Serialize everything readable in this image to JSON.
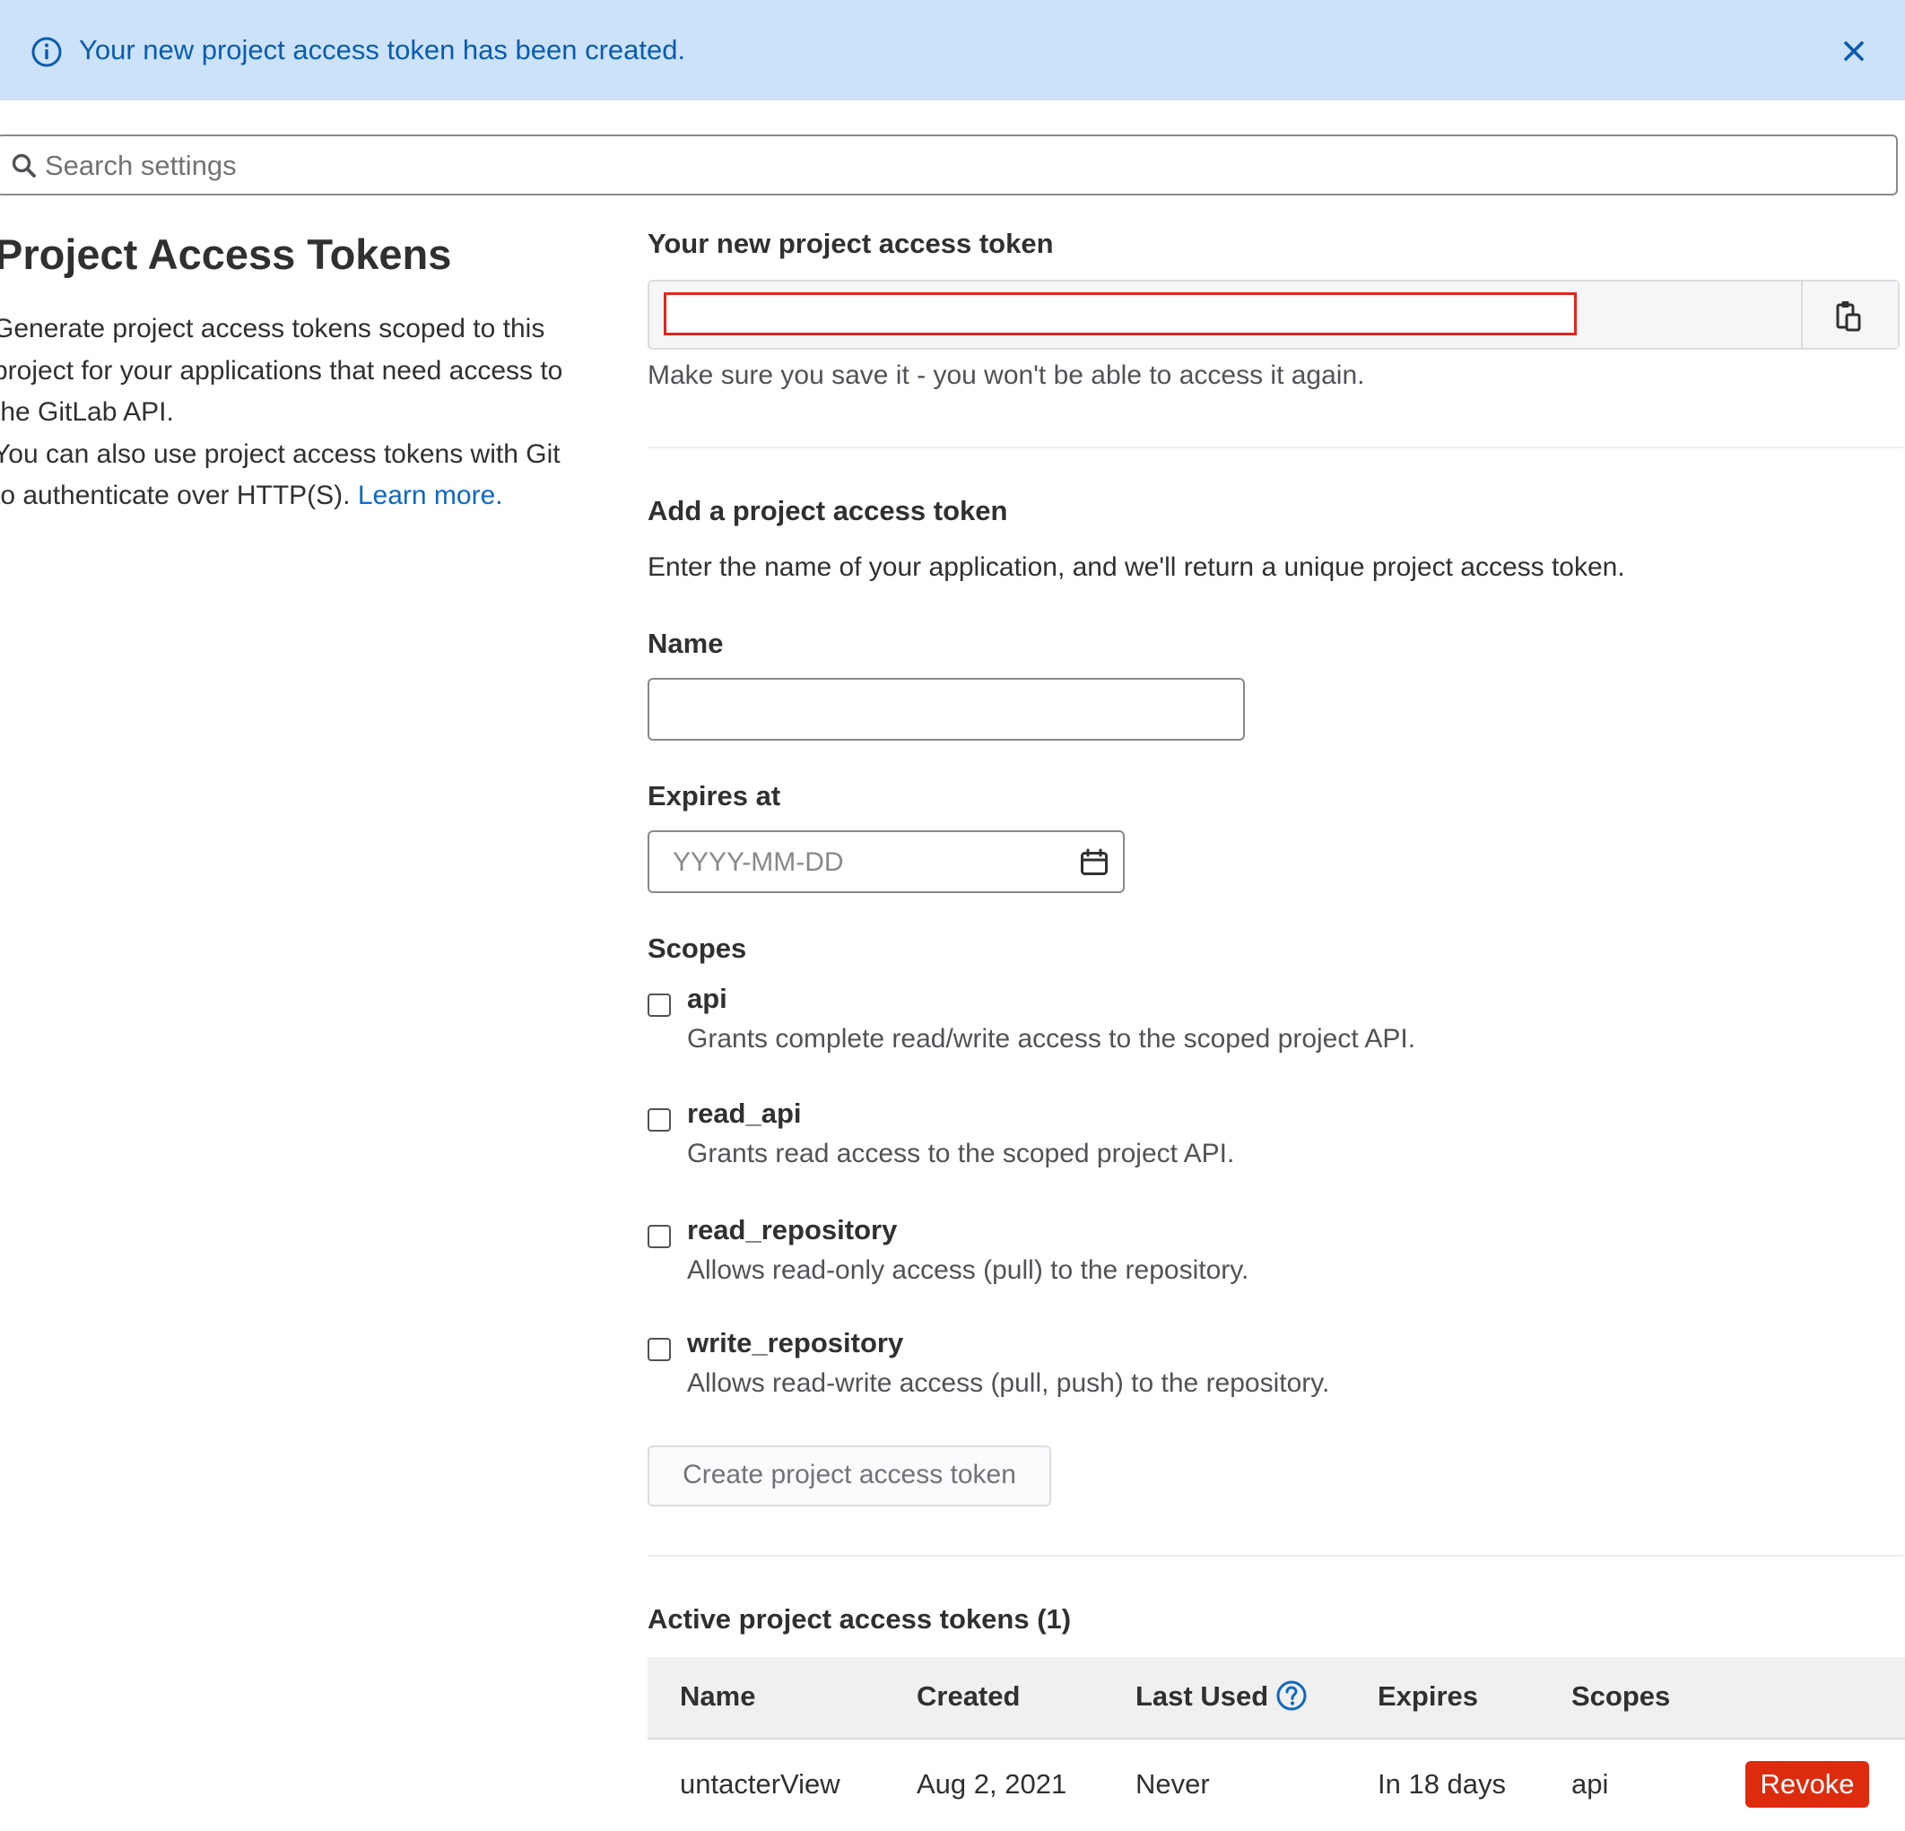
{
  "alert": {
    "message": "Your new project access token has been created.",
    "icon": "info-circle-icon",
    "close_icon": "close-icon"
  },
  "search": {
    "placeholder": "Search settings"
  },
  "sidebar": {
    "title": "Project Access Tokens",
    "description_1": "Generate project access tokens scoped to this project for your applications that need access to the GitLab API.",
    "description_2": "You can also use project access tokens with Git to authenticate over HTTP(S).",
    "learn_more": "Learn more."
  },
  "new_token": {
    "label": "Your new project access token",
    "value": "",
    "help": "Make sure you save it - you won't be able to access it again.",
    "copy_icon": "clipboard-icon"
  },
  "add_token": {
    "heading": "Add a project access token",
    "description": "Enter the name of your application, and we'll return a unique project access token.",
    "name_label": "Name",
    "name_value": "",
    "expires_label": "Expires at",
    "expires_placeholder": "YYYY-MM-DD",
    "scopes_label": "Scopes",
    "scopes": [
      {
        "name": "api",
        "description": "Grants complete read/write access to the scoped project API.",
        "checked": false
      },
      {
        "name": "read_api",
        "description": "Grants read access to the scoped project API.",
        "checked": false
      },
      {
        "name": "read_repository",
        "description": "Allows read-only access (pull) to the repository.",
        "checked": false
      },
      {
        "name": "write_repository",
        "description": "Allows read-write access (pull, push) to the repository.",
        "checked": false
      }
    ],
    "create_button": "Create project access token"
  },
  "active_tokens": {
    "heading": "Active project access tokens (1)",
    "columns": [
      "Name",
      "Created",
      "Last Used",
      "Expires",
      "Scopes"
    ],
    "rows": [
      {
        "name": "untacterView",
        "created": "Aug 2, 2021",
        "last_used": "Never",
        "expires": "In 18 days",
        "scopes": "api",
        "action": "Revoke"
      }
    ]
  },
  "colors": {
    "alert_bg": "#cbe2f9",
    "alert_text": "#0b5cad",
    "link": "#1068bf",
    "revoke": "#dd2b0e",
    "highlight_border": "#e1261c"
  }
}
